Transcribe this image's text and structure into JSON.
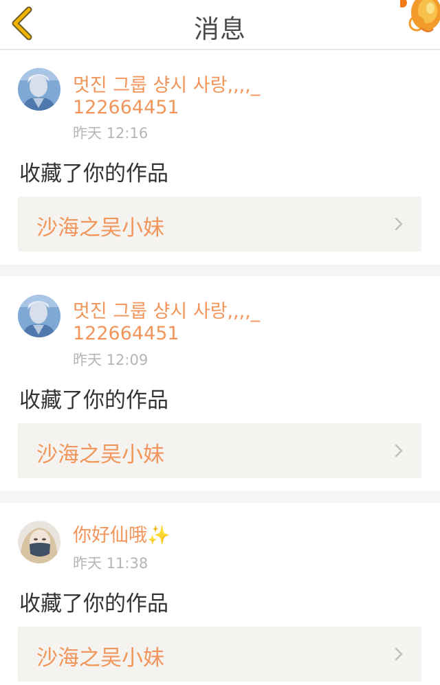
{
  "header": {
    "title": "消息",
    "back_icon": "chevron-left-icon",
    "decoration_icon": "lantern-icon"
  },
  "colors": {
    "accent": "#f2955a",
    "back_arrow": "#f0b400",
    "link_bg": "#f4f3ef",
    "separator": "#f5f5f5"
  },
  "notifications": [
    {
      "user": "멋진 그룹 샹시 사랑,,,,_122664451",
      "time": "昨天 12:16",
      "message": "收藏了你的作品",
      "work": "沙海之吴小妹",
      "avatar": "avatar-blue-hair"
    },
    {
      "user": "멋진 그룹 샹시 사랑,,,,_122664451",
      "time": "昨天 12:09",
      "message": "收藏了你的作品",
      "work": "沙海之吴小妹",
      "avatar": "avatar-blue-hair"
    },
    {
      "user": "你好仙哦✨",
      "time": "昨天 11:38",
      "message": "收藏了你的作品",
      "work": "沙海之吴小妹",
      "avatar": "avatar-blonde-masked"
    }
  ]
}
